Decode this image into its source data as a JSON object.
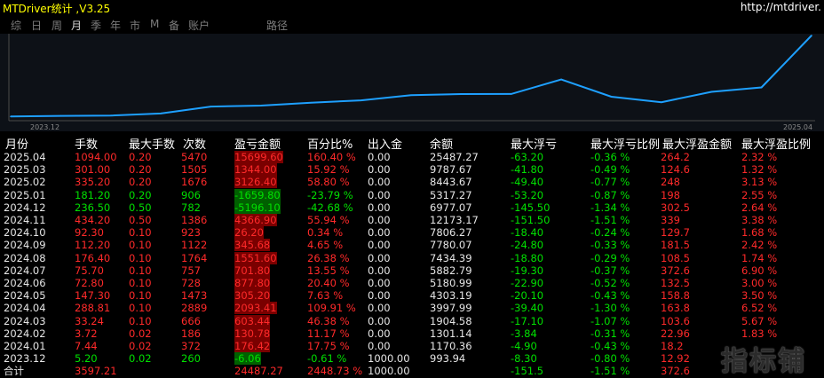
{
  "window": {
    "title": "MTDriver统计 ,V3.25",
    "url": "http://mtdriver."
  },
  "tabs": [
    {
      "label": "综"
    },
    {
      "label": "日"
    },
    {
      "label": "周"
    },
    {
      "label": "月"
    },
    {
      "label": "季"
    },
    {
      "label": "年"
    },
    {
      "label": "市"
    },
    {
      "label": "M"
    },
    {
      "label": "备"
    },
    {
      "label": "账户"
    },
    {
      "label": "路径"
    }
  ],
  "active_tab": "月",
  "chart_data": {
    "type": "line",
    "x_start_label": "2023.12",
    "x_end_label": "2025.04",
    "line_color": "#1ea0ff",
    "x": [
      "2023.12",
      "2024.01",
      "2024.02",
      "2024.03",
      "2024.04",
      "2024.05",
      "2024.06",
      "2024.07",
      "2024.08",
      "2024.09",
      "2024.10",
      "2024.11",
      "2024.12",
      "2025.01",
      "2025.02",
      "2025.03",
      "2025.04"
    ],
    "y": [
      993.94,
      1170.36,
      1301.14,
      1904.58,
      3997.99,
      4303.19,
      5180.99,
      5882.79,
      7434.39,
      7780.07,
      7806.27,
      12173.17,
      6977.07,
      5317.27,
      8443.67,
      9787.67,
      25487.27
    ]
  },
  "table": {
    "headers": [
      "月份",
      "手数",
      "最大手数",
      "次数",
      "盈亏金额",
      "百分比%",
      "出入金",
      "余额",
      "最大浮亏",
      "最大浮亏比例",
      "最大浮盈金额",
      "最大浮盈比例"
    ],
    "rows": [
      {
        "month": "2025.04",
        "lots": "1094.00",
        "maxlots": "0.20",
        "count": "5470",
        "pl": "15699.60",
        "pct": "160.40 %",
        "flow": "0.00",
        "balance": "25487.27",
        "maxloss": "-63.20",
        "maxlosspct": "-0.36 %",
        "maxgain": "264.2",
        "maxgainpct": "2.32 %",
        "sign": "pos"
      },
      {
        "month": "2025.03",
        "lots": "301.00",
        "maxlots": "0.20",
        "count": "1505",
        "pl": "1344.00",
        "pct": "15.92 %",
        "flow": "0.00",
        "balance": "9787.67",
        "maxloss": "-41.80",
        "maxlosspct": "-0.49 %",
        "maxgain": "124.6",
        "maxgainpct": "1.32 %",
        "sign": "pos"
      },
      {
        "month": "2025.02",
        "lots": "335.20",
        "maxlots": "0.20",
        "count": "1676",
        "pl": "3126.40",
        "pct": "58.80 %",
        "flow": "0.00",
        "balance": "8443.67",
        "maxloss": "-49.40",
        "maxlosspct": "-0.77 %",
        "maxgain": "248",
        "maxgainpct": "3.13 %",
        "sign": "pos"
      },
      {
        "month": "2025.01",
        "lots": "181.20",
        "maxlots": "0.20",
        "count": "906",
        "pl": "-1659.80",
        "pct": "-23.79 %",
        "flow": "0.00",
        "balance": "5317.27",
        "maxloss": "-53.20",
        "maxlosspct": "-0.87 %",
        "maxgain": "198",
        "maxgainpct": "2.55 %",
        "sign": "neg"
      },
      {
        "month": "2024.12",
        "lots": "236.50",
        "maxlots": "0.50",
        "count": "782",
        "pl": "-5196.10",
        "pct": "-42.68 %",
        "flow": "0.00",
        "balance": "6977.07",
        "maxloss": "-145.50",
        "maxlosspct": "-1.34 %",
        "maxgain": "302.5",
        "maxgainpct": "2.64 %",
        "sign": "neg"
      },
      {
        "month": "2024.11",
        "lots": "434.20",
        "maxlots": "0.50",
        "count": "1386",
        "pl": "4366.90",
        "pct": "55.94 %",
        "flow": "0.00",
        "balance": "12173.17",
        "maxloss": "-151.50",
        "maxlosspct": "-1.51 %",
        "maxgain": "339",
        "maxgainpct": "3.38 %",
        "sign": "pos"
      },
      {
        "month": "2024.10",
        "lots": "92.30",
        "maxlots": "0.10",
        "count": "923",
        "pl": "26.20",
        "pct": "0.34 %",
        "flow": "0.00",
        "balance": "7806.27",
        "maxloss": "-18.40",
        "maxlosspct": "-0.24 %",
        "maxgain": "129.7",
        "maxgainpct": "1.68 %",
        "sign": "pos"
      },
      {
        "month": "2024.09",
        "lots": "112.20",
        "maxlots": "0.10",
        "count": "1122",
        "pl": "345.68",
        "pct": "4.65 %",
        "flow": "0.00",
        "balance": "7780.07",
        "maxloss": "-24.80",
        "maxlosspct": "-0.33 %",
        "maxgain": "181.5",
        "maxgainpct": "2.42 %",
        "sign": "pos"
      },
      {
        "month": "2024.08",
        "lots": "176.40",
        "maxlots": "0.10",
        "count": "1764",
        "pl": "1551.60",
        "pct": "26.38 %",
        "flow": "0.00",
        "balance": "7434.39",
        "maxloss": "-18.80",
        "maxlosspct": "-0.29 %",
        "maxgain": "108.5",
        "maxgainpct": "1.74 %",
        "sign": "pos"
      },
      {
        "month": "2024.07",
        "lots": "75.70",
        "maxlots": "0.10",
        "count": "757",
        "pl": "701.80",
        "pct": "13.55 %",
        "flow": "0.00",
        "balance": "5882.79",
        "maxloss": "-19.30",
        "maxlosspct": "-0.37 %",
        "maxgain": "372.6",
        "maxgainpct": "6.90 %",
        "sign": "pos"
      },
      {
        "month": "2024.06",
        "lots": "72.80",
        "maxlots": "0.10",
        "count": "728",
        "pl": "877.80",
        "pct": "20.40 %",
        "flow": "0.00",
        "balance": "5180.99",
        "maxloss": "-22.90",
        "maxlosspct": "-0.52 %",
        "maxgain": "132.5",
        "maxgainpct": "3.00 %",
        "sign": "pos"
      },
      {
        "month": "2024.05",
        "lots": "147.30",
        "maxlots": "0.10",
        "count": "1473",
        "pl": "305.20",
        "pct": "7.63 %",
        "flow": "0.00",
        "balance": "4303.19",
        "maxloss": "-20.10",
        "maxlosspct": "-0.43 %",
        "maxgain": "158.8",
        "maxgainpct": "3.50 %",
        "sign": "pos"
      },
      {
        "month": "2024.04",
        "lots": "288.81",
        "maxlots": "0.10",
        "count": "2889",
        "pl": "2093.41",
        "pct": "109.91 %",
        "flow": "0.00",
        "balance": "3997.99",
        "maxloss": "-39.40",
        "maxlosspct": "-1.30 %",
        "maxgain": "163.8",
        "maxgainpct": "6.52 %",
        "sign": "pos"
      },
      {
        "month": "2024.03",
        "lots": "33.24",
        "maxlots": "0.10",
        "count": "666",
        "pl": "603.44",
        "pct": "46.38 %",
        "flow": "0.00",
        "balance": "1904.58",
        "maxloss": "-17.10",
        "maxlosspct": "-1.07 %",
        "maxgain": "103.6",
        "maxgainpct": "5.67 %",
        "sign": "pos"
      },
      {
        "month": "2024.02",
        "lots": "3.72",
        "maxlots": "0.02",
        "count": "186",
        "pl": "130.78",
        "pct": "11.17 %",
        "flow": "0.00",
        "balance": "1301.14",
        "maxloss": "-3.84",
        "maxlosspct": "-0.31 %",
        "maxgain": "22.96",
        "maxgainpct": "1.83 %",
        "sign": "pos"
      },
      {
        "month": "2024.01",
        "lots": "7.44",
        "maxlots": "0.02",
        "count": "372",
        "pl": "176.42",
        "pct": "17.75 %",
        "flow": "0.00",
        "balance": "1170.36",
        "maxloss": "-4.90",
        "maxlosspct": "-0.43 %",
        "maxgain": "18.2",
        "maxgainpct": "",
        "sign": "pos"
      },
      {
        "month": "2023.12",
        "lots": "5.20",
        "maxlots": "0.02",
        "count": "260",
        "pl": "-6.06",
        "pct": "-0.61 %",
        "flow": "1000.00",
        "balance": "993.94",
        "maxloss": "-8.30",
        "maxlosspct": "-0.80 %",
        "maxgain": "12.92",
        "maxgainpct": "",
        "sign": "neg"
      }
    ],
    "total": {
      "label": "合计",
      "lots": "3597.21",
      "pl": "24487.27",
      "pct": "2448.73 %",
      "flow": "1000.00",
      "maxloss": "-151.5",
      "maxlosspct": "-1.51 %",
      "maxgain": "372.6"
    }
  },
  "watermark": {
    "text": "指标铺"
  }
}
